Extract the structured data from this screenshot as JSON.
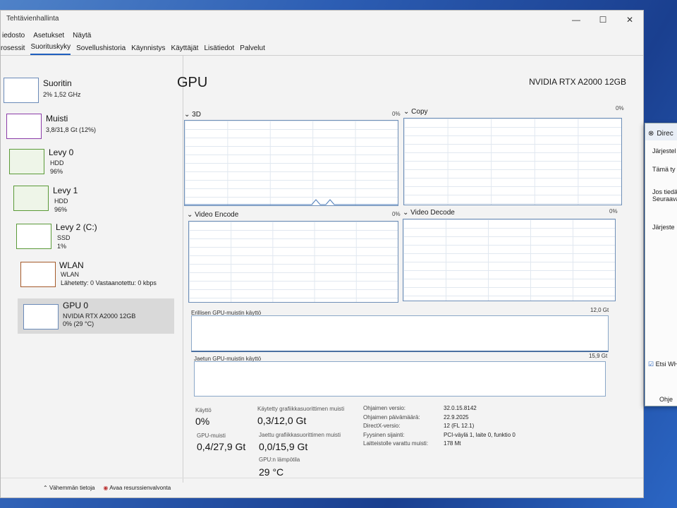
{
  "window": {
    "title": "Tehtävienhallinta",
    "controls": [
      "—",
      "☐",
      "✕"
    ]
  },
  "menu": [
    "iedosto",
    "Asetukset",
    "Näytä"
  ],
  "tabs": [
    "rosessit",
    "Suorituskyky",
    "Sovellushistoria",
    "Käynnistys",
    "Käyttäjät",
    "Lisätiedot",
    "Palvelut"
  ],
  "sidebar": [
    {
      "name": "Suoritin",
      "l1": "2% 1,52 GHz",
      "l2": "",
      "l3": ""
    },
    {
      "name": "Muisti",
      "l1": "3,8/31,8 Gt (12%)",
      "l2": "",
      "l3": ""
    },
    {
      "name": "Levy 0",
      "l1": "HDD",
      "l2": "96%",
      "l3": ""
    },
    {
      "name": "Levy 1",
      "l1": "HDD",
      "l2": "96%",
      "l3": ""
    },
    {
      "name": "Levy 2 (C:)",
      "l1": "SSD",
      "l2": "1%",
      "l3": ""
    },
    {
      "name": "WLAN",
      "l1": "WLAN",
      "l2": "Lähetetty: 0 Vastaanotettu: 0 kbps",
      "l3": ""
    },
    {
      "name": "GPU 0",
      "l1": "NVIDIA RTX A2000 12GB",
      "l2": "0% (29 °C)",
      "l3": ""
    }
  ],
  "gpu": {
    "title": "GPU",
    "model": "NVIDIA RTX A2000 12GB",
    "engines": [
      {
        "label": "3D",
        "pct": "0%"
      },
      {
        "label": "Copy",
        "pct": "0%"
      },
      {
        "label": "Video Encode",
        "pct": "0%"
      },
      {
        "label": "Video Decode",
        "pct": "0%"
      }
    ],
    "dedicated": {
      "label": "Erillisen GPU-muistin käyttö",
      "max": "12,0 Gt"
    },
    "shared": {
      "label": "Jaetun GPU-muistin käyttö",
      "max": "15,9 Gt"
    },
    "stats": {
      "usage_label": "Käyttö",
      "usage": "0%",
      "gpumem_label": "GPU-muisti",
      "gpumem": "0,4/27,9 Gt",
      "ded_label": "Käytetty grafiikkasuorittimen muisti",
      "ded": "0,3/12,0 Gt",
      "shared_label": "Jaettu grafiikkasuorittimen muisti",
      "shared": "0,0/15,9 Gt",
      "temp_label": "GPU:n lämpötila",
      "temp": "29 °C"
    },
    "details": [
      {
        "k": "Ohjaimen versio:",
        "v": "32.0.15.8142"
      },
      {
        "k": "Ohjaimen päivämäärä:",
        "v": "22.9.2025"
      },
      {
        "k": "DirectX-versio:",
        "v": "12 (FL 12.1)"
      },
      {
        "k": "Fyysinen sijainti:",
        "v": "PCI-väylä 1, laite 0, funktio 0"
      },
      {
        "k": "Laitteistolle varattu muisti:",
        "v": "178 Mt"
      }
    ]
  },
  "footer": {
    "less": "Vähemmän tietoja",
    "monitor": "Avaa resurssienvalvonta"
  },
  "dialog": {
    "title": "Direc",
    "t1": "Järjestel",
    "t2": "Tämä ty",
    "t3": "Jos tiedä",
    "t4": "Seuraava",
    "t5": "Järjeste",
    "check": "Etsi WHC",
    "ok": "Ohje"
  }
}
